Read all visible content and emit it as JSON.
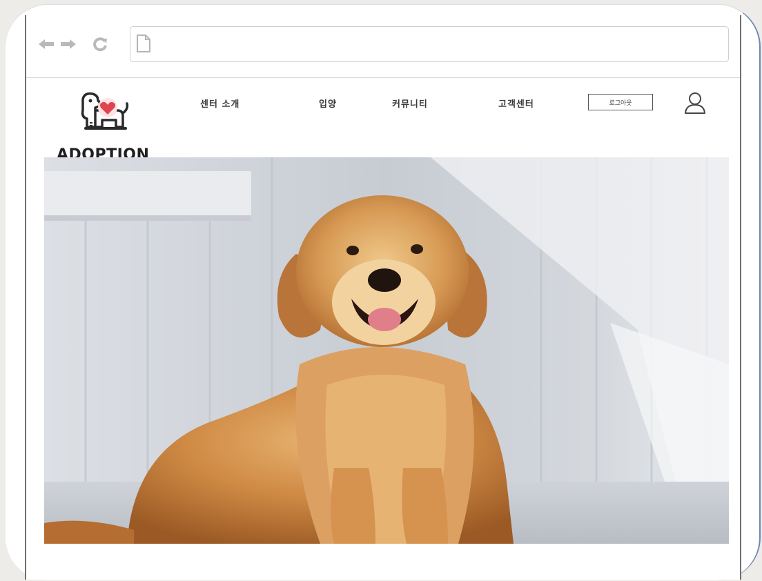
{
  "header": {
    "logo_text": "ADOPTION",
    "menu": [
      {
        "label": "센터 소개"
      },
      {
        "label": "입양"
      },
      {
        "label": "커뮤니티"
      },
      {
        "label": "고객센터"
      }
    ],
    "logout_label": "로그아웃"
  },
  "colors": {
    "accent_heart": "#e0444f",
    "border_blue": "#6d88b3",
    "text_dark": "#202020"
  },
  "icons": {
    "back": "arrow-left-icon",
    "forward": "arrow-right-icon",
    "reload": "reload-icon",
    "page": "page-icon",
    "user": "user-icon",
    "logo": "dog-heart-logo-icon"
  }
}
